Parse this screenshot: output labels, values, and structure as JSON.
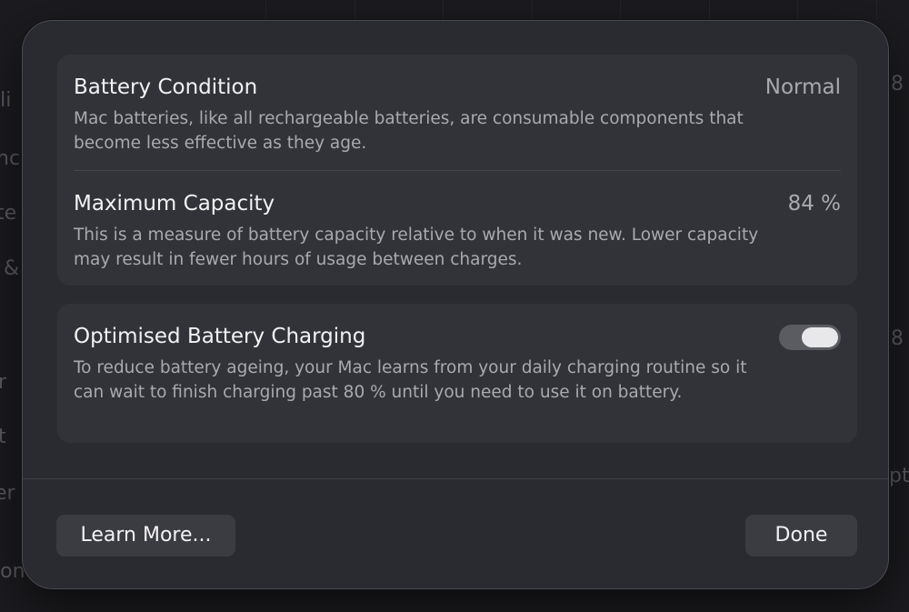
{
  "dialog": {
    "battery_condition": {
      "title": "Battery Condition",
      "value": "Normal",
      "description": "Mac batteries, like all rechargeable batteries, are consumable components that become less effective as they age."
    },
    "maximum_capacity": {
      "title": "Maximum Capacity",
      "value": "84 %",
      "description": "This is a measure of battery capacity relative to when it was new. Lower capacity may result in fewer hours of usage between charges."
    },
    "optimised_charging": {
      "title": "Optimised Battery Charging",
      "enabled": true,
      "description": "To reduce battery ageing, your Mac learns from your daily charging routine so it can wait to finish charging past 80 % until you need to use it on battery."
    },
    "buttons": {
      "learn_more": "Learn More...",
      "done": "Done"
    }
  },
  "background_fragments": [
    "ili",
    "nc",
    "te",
    "&",
    "r",
    "t",
    "er",
    "ion",
    "8",
    "8",
    "pt"
  ],
  "colors": {
    "sheet": "#2a2b30",
    "group": "#323338",
    "button": "#3b3c41",
    "toggle_track": "#5b5c61",
    "toggle_knob": "#e8e8ea"
  }
}
